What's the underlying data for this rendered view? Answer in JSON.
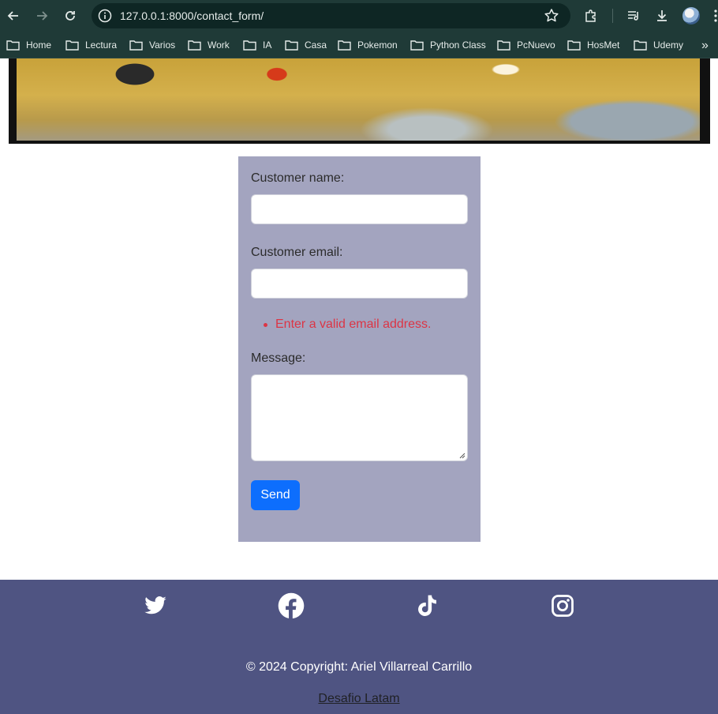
{
  "browser": {
    "url": "127.0.0.1:8000/contact_form/",
    "bookmarks": [
      "Home",
      "Lectura",
      "Varios",
      "Work",
      "IA",
      "Casa",
      "Pokemon",
      "Python Class",
      "PcNuevo",
      "HosMet",
      "Udemy"
    ],
    "more_label": "»"
  },
  "form": {
    "name_label": "Customer name:",
    "name_value": "",
    "email_label": "Customer email:",
    "email_value": "",
    "email_error": "Enter a valid email address.",
    "message_label": "Message:",
    "message_value": "",
    "send_label": "Send"
  },
  "footer": {
    "social": [
      "twitter-icon",
      "facebook-icon",
      "tiktok-icon",
      "instagram-icon"
    ],
    "copyright": "© 2024 Copyright: Ariel Villarreal Carrillo",
    "link_text": "Desafio Latam"
  },
  "colors": {
    "chrome": "#1f3a37",
    "form_bg": "#a3a4bf",
    "error": "#dc3545",
    "button": "#0d6efd",
    "footer_bg": "#4f5482"
  }
}
